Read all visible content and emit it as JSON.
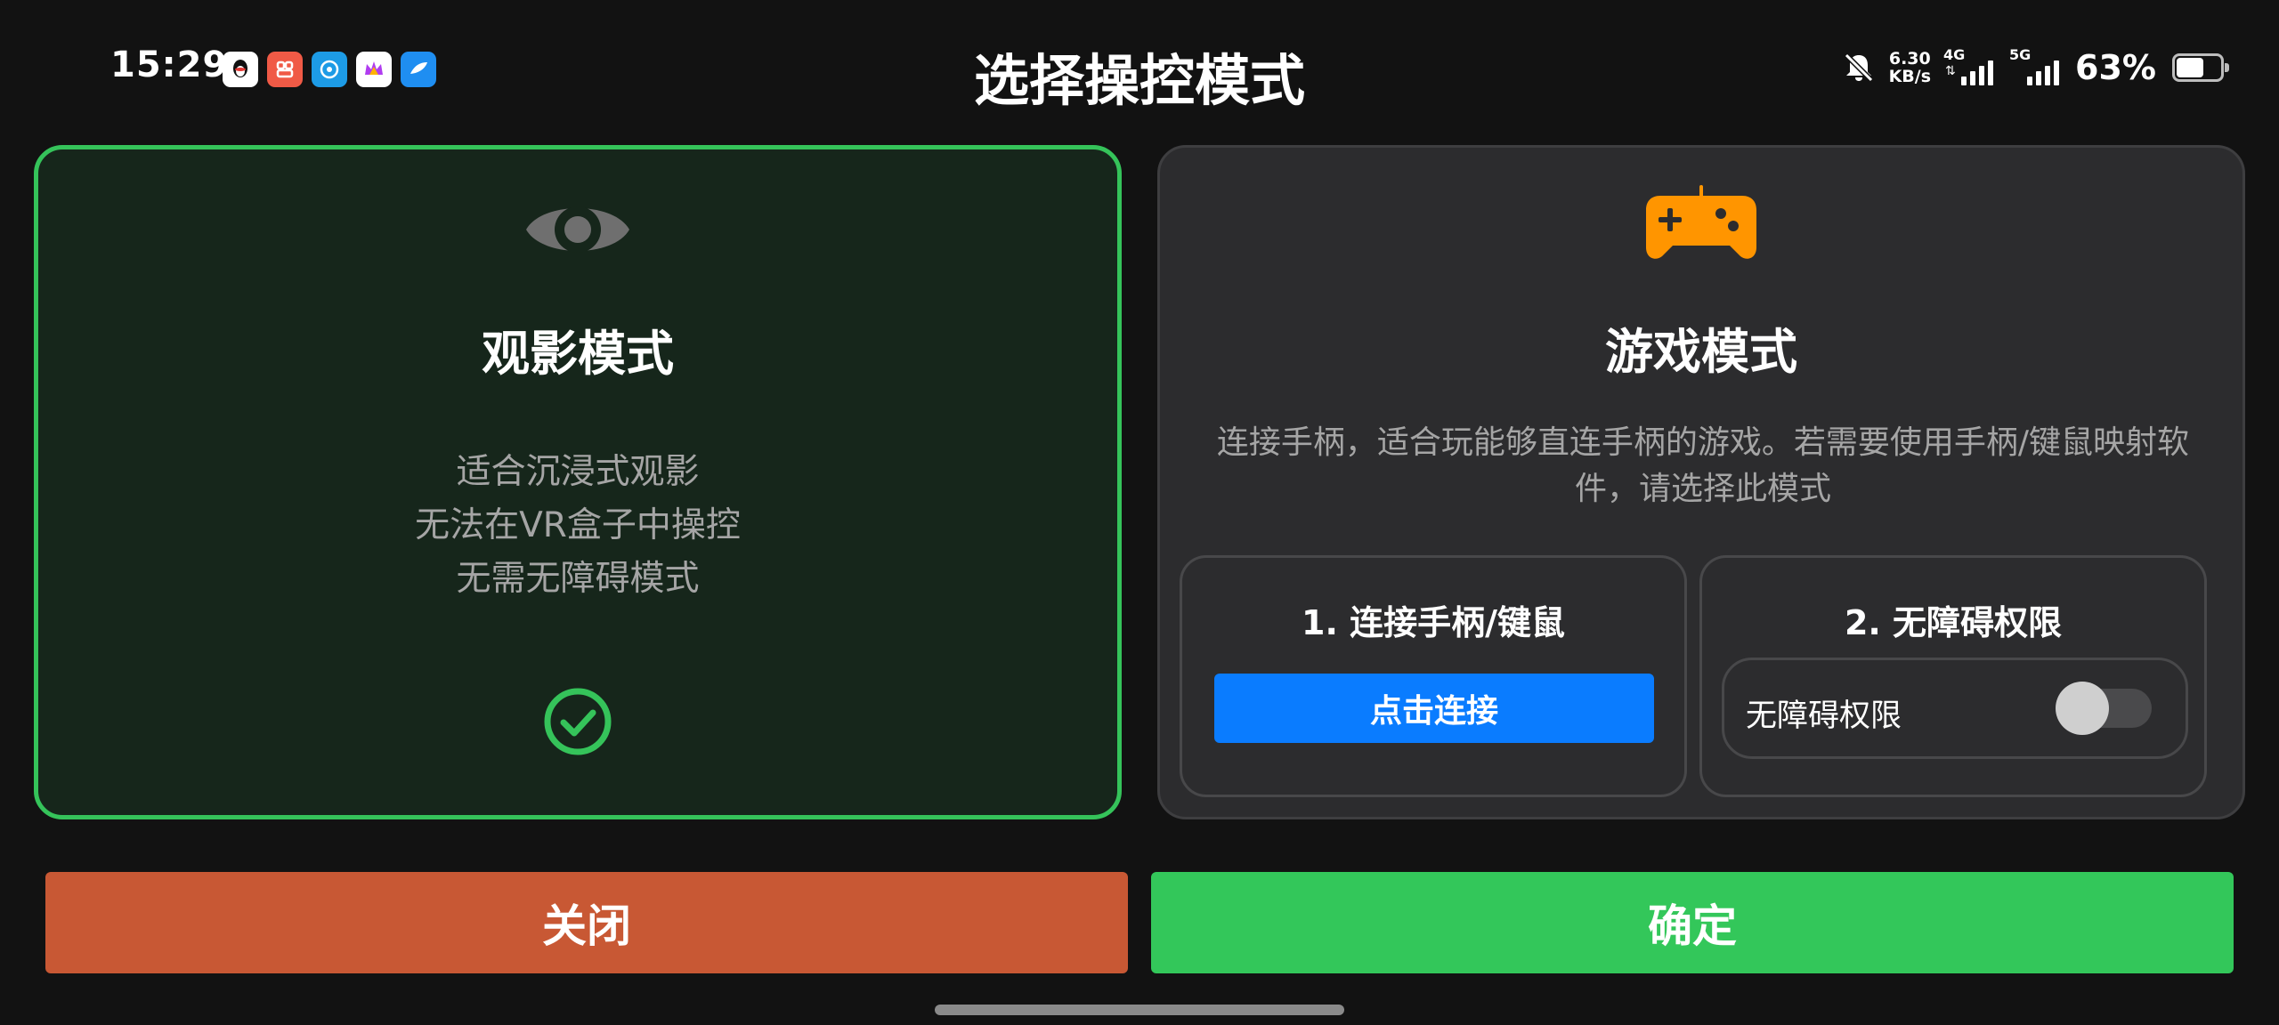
{
  "status_bar": {
    "time": "15:29",
    "notification_apps": [
      "qq-icon",
      "xiaohongshu-icon",
      "weibo-icon",
      "crown-app-icon",
      "feather-app-icon"
    ],
    "net_speed_value": "6.30",
    "net_speed_unit": "KB/s",
    "signal_1_tag": "4G",
    "signal_2_tag": "5G",
    "battery_percent": "63%",
    "battery_level": 0.63
  },
  "page": {
    "title": "选择操控模式"
  },
  "view_mode": {
    "title": "观影模式",
    "description": [
      "适合沉浸式观影",
      "无法在VR盒子中操控",
      "无需无障碍模式"
    ],
    "selected": true,
    "icon": "eye-icon",
    "accent_color": "#35c35a"
  },
  "game_mode": {
    "title": "游戏模式",
    "description": "连接手柄，适合玩能够直连手柄的游戏。若需要使用手柄/键鼠映射软件，请选择此模式",
    "icon": "gamepad-icon",
    "icon_color": "#ff9500",
    "step1": {
      "title": "1. 连接手柄/键鼠",
      "button_label": "点击连接"
    },
    "step2": {
      "title": "2. 无障碍权限",
      "toggle_label": "无障碍权限",
      "toggle_on": false
    }
  },
  "actions": {
    "close_label": "关闭",
    "confirm_label": "确定",
    "close_color": "#c85834",
    "confirm_color": "#33c75a"
  }
}
